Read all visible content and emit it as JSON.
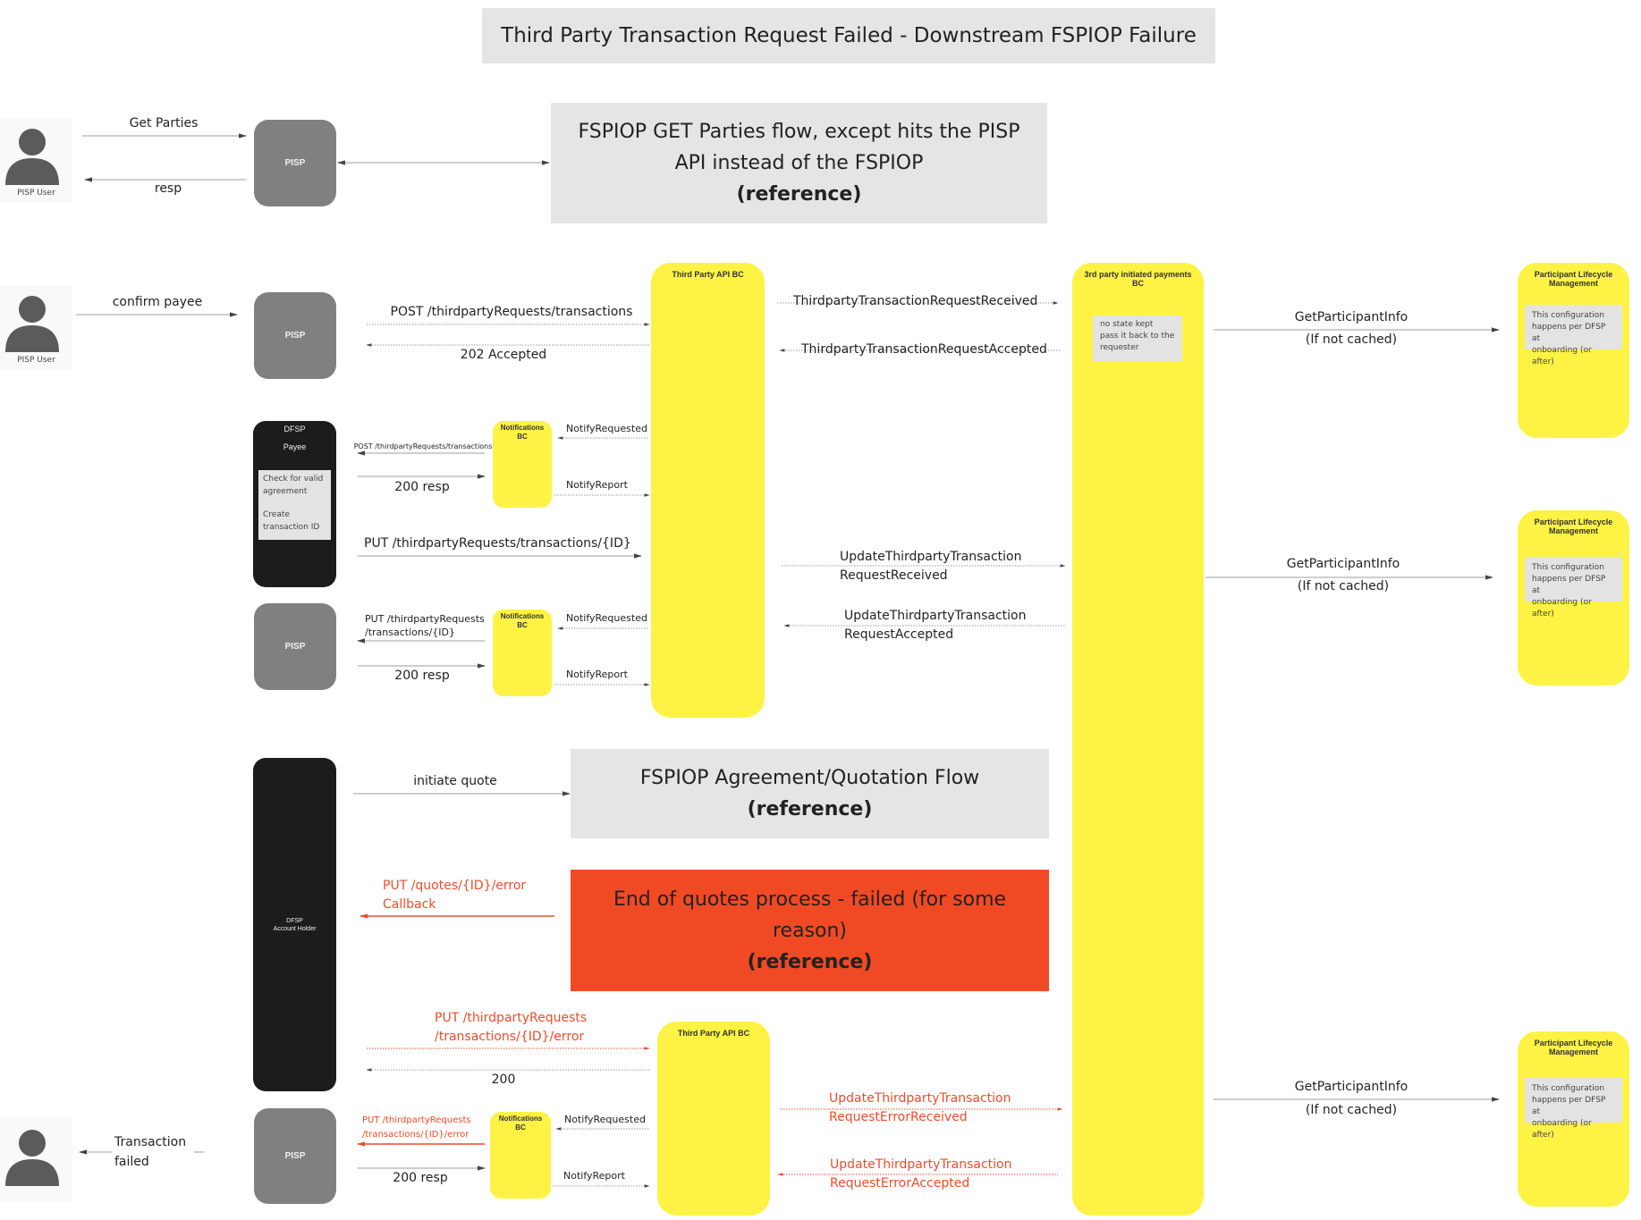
{
  "title": "Third Party Transaction Request Failed - Downstream FSPIOP Failure",
  "references": {
    "get_parties": {
      "line1": "FSPIOP GET Parties flow, except hits the PISP",
      "line2": "API instead of the FSPIOP",
      "tag": "(reference)"
    },
    "quotation": {
      "line1": "FSPIOP Agreement/Quotation Flow",
      "tag": "(reference)"
    },
    "quotes_failed": {
      "line1": "End of quotes process - failed (for some",
      "line2": "reason)",
      "tag": "(reference)"
    }
  },
  "actors": {
    "pisp_user_label": "PISP User",
    "pisp_label": "PISP",
    "dfsp_payee": {
      "line1": "DFSP",
      "line2": "Payee",
      "note_line1": "Check for valid",
      "note_line2": "agreement",
      "note_line3": "Create",
      "note_line4": "transaction ID"
    },
    "dfsp_account_holder": {
      "line1": "DFSP",
      "line2": "Account Holder"
    },
    "third_party_api_bc": "Third Party API BC",
    "notifications_bc": {
      "line1": "Notifications",
      "line2": "BC"
    },
    "tp_payments_bc": {
      "line1": "3rd party initiated payments",
      "line2": "BC",
      "note_line1": "no state kept",
      "note_line2": "pass it back to the",
      "note_line3": "requester"
    },
    "participant_lifecycle": {
      "line1": "Participant Lifecycle",
      "line2": "Management",
      "note_line1": "This configuration",
      "note_line2": "happens per DFSP at",
      "note_line3": "onboarding (or after)"
    }
  },
  "messages": {
    "get_parties": "Get Parties",
    "resp": "resp",
    "confirm_payee": "confirm payee",
    "post_tp_transactions": "POST /thirdpartyRequests/transactions",
    "accepted_202": "202 Accepted",
    "tp_request_received": "ThirdpartyTransactionRequestReceived",
    "tp_request_accepted": "ThirdpartyTransactionRequestAccepted",
    "get_participant_info": "GetParticipantInfo",
    "if_not_cached": "(If not cached)",
    "post_tp_transactions_small": "POST /thirdpartyRequests/transactions",
    "resp_200": "200 resp",
    "notify_requested": "NotifyRequested",
    "notify_report": "NotifyReport",
    "put_tp_transactions_id": "PUT /thirdpartyRequests/transactions/{ID}",
    "update_received_l1": "UpdateThirdpartyTransaction",
    "update_received_l2": "RequestReceived",
    "update_accepted_l1": "UpdateThirdpartyTransaction",
    "update_accepted_l2": "RequestAccepted",
    "put_tp_id_l1": "PUT /thirdpartyRequests",
    "put_tp_id_l2": "/transactions/{ID}",
    "initiate_quote": "initiate quote",
    "put_quotes_error_l1": "PUT /quotes/{ID}/error",
    "put_quotes_error_l2": "Callback",
    "put_tp_error_l1": "PUT /thirdpartyRequests",
    "put_tp_error_l2": "/transactions/{ID}/error",
    "ok_200": "200",
    "update_error_received_l1": "UpdateThirdpartyTransaction",
    "update_error_received_l2": "RequestErrorReceived",
    "update_error_accepted_l1": "UpdateThirdpartyTransaction",
    "update_error_accepted_l2": "RequestErrorAccepted",
    "transaction_failed_l1": "Transaction",
    "transaction_failed_l2": "failed"
  },
  "colors": {
    "participant_yellow": "#fef245",
    "pisp_gray": "#808080",
    "dfsp_black": "#1c1c1c",
    "reference_gray": "#e5e5e5",
    "failure_red": "#f04a24",
    "error_text_red": "#ee4b2b"
  }
}
